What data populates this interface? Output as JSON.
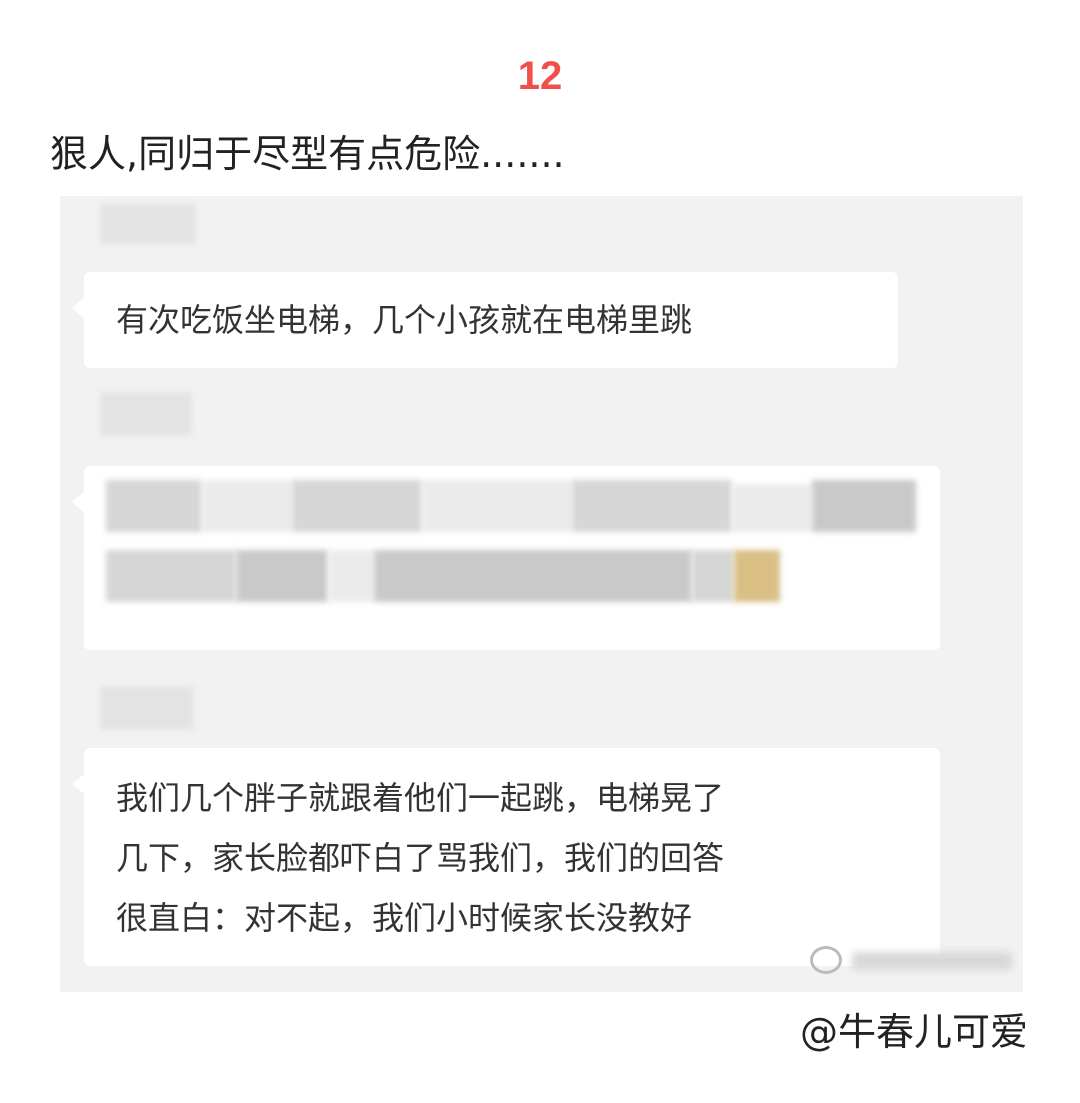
{
  "post": {
    "number": "12",
    "caption": "狠人,同归于尽型有点危险.......",
    "author": "@牛春儿可爱"
  },
  "chat": {
    "messages": [
      {
        "lines": [
          "有次吃饭坐电梯，几个小孩就在电梯里跳"
        ]
      },
      {
        "lines": []
      },
      {
        "lines": [
          "我们几个胖子就跟着他们一起跳，电梯晃了",
          "几下，家长脸都吓白了骂我们，我们的回答",
          "很直白：对不起，我们小时候家长没教好"
        ]
      }
    ]
  },
  "colors": {
    "number_accent": "#f0504a",
    "chat_background": "#f2f2f2",
    "bubble_background": "#ffffff"
  }
}
